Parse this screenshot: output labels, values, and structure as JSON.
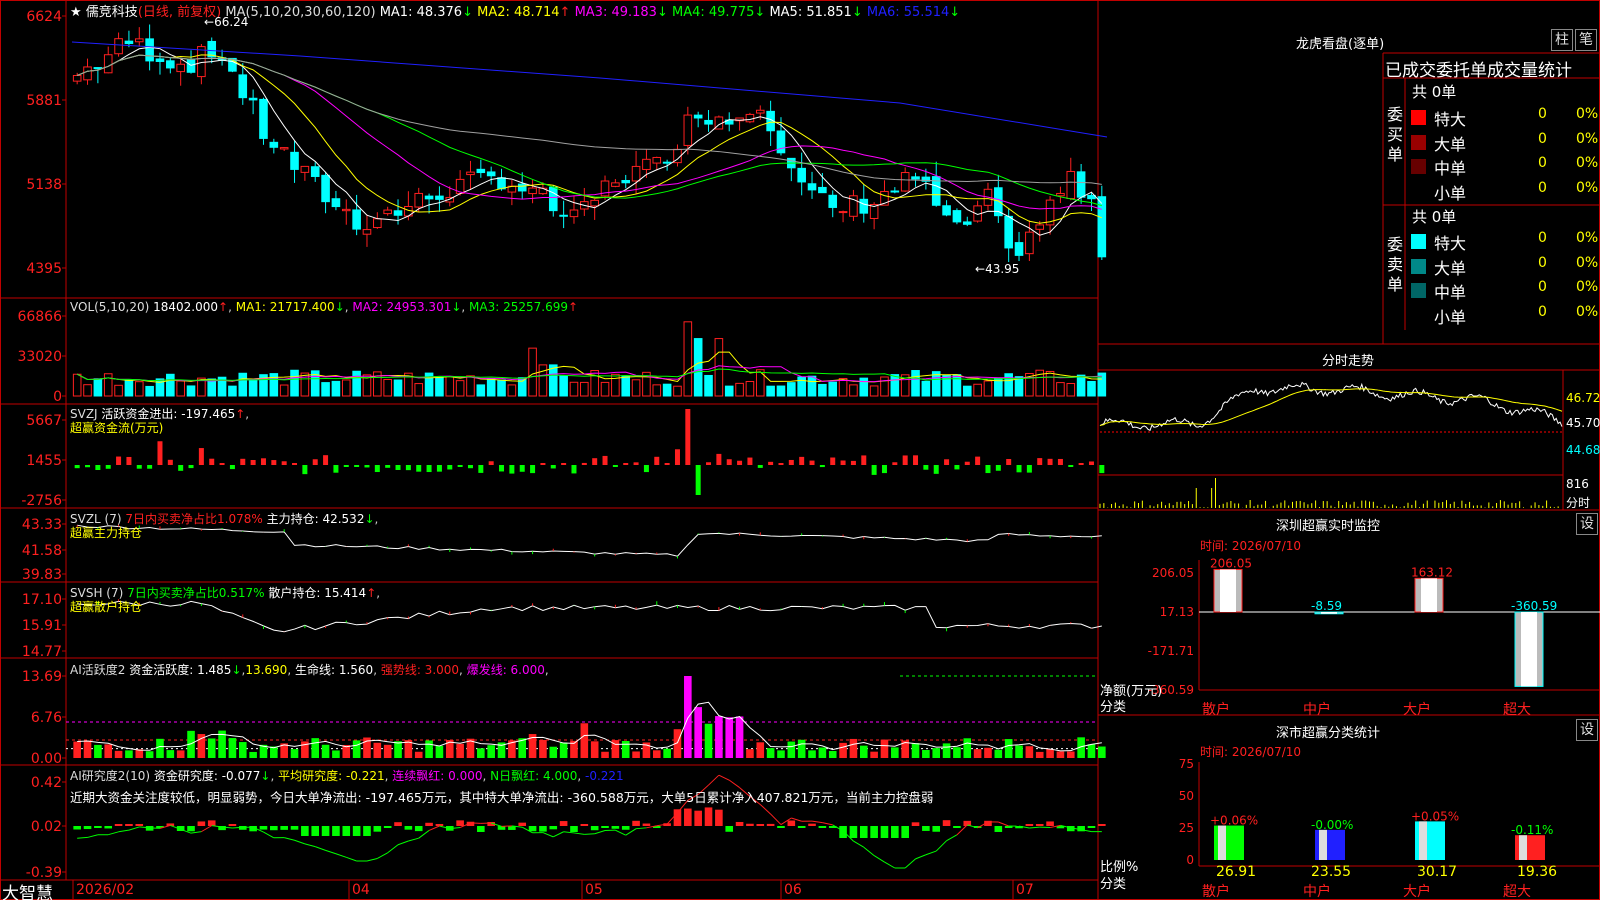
{
  "colors": {
    "up": "#ff2020",
    "down": "#00ffff",
    "ma1": "#ffffff",
    "ma2": "#ffff00",
    "ma3": "#ff00ff",
    "ma4": "#00ff00",
    "ma5": "#a0a0a0",
    "ma6": "#2020ff",
    "frame": "#c00000"
  },
  "main_chart": {
    "icon": "star-icon",
    "stock_name": "儒竞科技",
    "period": "(日线, 前复权)",
    "ma_def": "MA(5,10,20,30,60,120)",
    "ma_values": [
      {
        "label": "MA1: 48.376",
        "arrow": "↓"
      },
      {
        "label": "MA2: 48.714",
        "arrow": "↑"
      },
      {
        "label": "MA3: 49.183",
        "arrow": "↓"
      },
      {
        "label": "MA4: 49.775",
        "arrow": "↓"
      },
      {
        "label": "MA5: 51.851",
        "arrow": "↓"
      },
      {
        "label": "MA6: 55.514",
        "arrow": "↓"
      }
    ],
    "y_ticks": [
      "6624",
      "5881",
      "5138",
      "4395"
    ],
    "high_note": "66.24",
    "low_note": "43.95"
  },
  "vol_panel": {
    "title": "VOL(5,10,20)",
    "value": "18402.000",
    "ma1": "MA1: 21717.400",
    "ma2": "MA2: 24953.301",
    "ma3": "MA3: 25257.699",
    "y_ticks": [
      "66866",
      "33020",
      "0"
    ]
  },
  "svzj_panel": {
    "title": "SVZJ",
    "desc": "活跃资金进出: -197.465",
    "arrow": "↑",
    "sub": "超赢资金流(万元)",
    "y_ticks": [
      "5667",
      "1455",
      "-2756"
    ]
  },
  "svzl_panel": {
    "title": "SVZL (7)",
    "ratio": "7日内买卖净占比1.078%",
    "holding": "主力持仓: 42.532",
    "arrow": "↓",
    "sub": "超赢主力持仓",
    "y_ticks": [
      "43.33",
      "41.58",
      "39.83"
    ]
  },
  "svsh_panel": {
    "title": "SVSH (7)",
    "ratio": "7日内买卖净占比0.517%",
    "holding": "散户持仓: 15.414",
    "arrow": "↑",
    "sub": "超赢散户持仓",
    "y_ticks": [
      "17.10",
      "15.91",
      "14.77"
    ]
  },
  "ai_panel": {
    "title": "AI活跃度2",
    "activity": "资金活跃度: 1.485",
    "v2": "13.690",
    "life": "生命线: 1.560",
    "strong": "强势线: 3.000",
    "burst": "爆发线: 6.000",
    "y_ticks": [
      "13.69",
      "6.76",
      "0.00"
    ]
  },
  "research_panel": {
    "title": "AI研究度2(10)",
    "research": "资金研究度: -0.077",
    "avg": "平均研究度: -0.221",
    "consec": "连续飘红: 0.000",
    "nday": "N日飘红: 4.000",
    "last": "-0.221",
    "note": "近期大资金关注度较低，明显弱势，今日大单净流出: -197.465万元，其中特大单净流出: -360.588万元，大单5日累计净入407.821万元，当前主力控盘弱",
    "y_ticks": [
      "0.42",
      "0.02",
      "-0.39"
    ]
  },
  "x_axis": {
    "labels": [
      "2026/02",
      "04",
      "05",
      "06",
      "07"
    ],
    "brand": "大智慧"
  },
  "right": {
    "lhb_title": "龙虎看盘(逐单)",
    "btn_bar": "柱",
    "btn_pen": "笔",
    "stat_title": "已成交委托单成交量统计",
    "buy": {
      "side": "委买单",
      "total": "共 0单",
      "rows": [
        {
          "name": "特大",
          "v": "0",
          "p": "0%",
          "c": "#ff0000"
        },
        {
          "name": "大单",
          "v": "0",
          "p": "0%",
          "c": "#990000"
        },
        {
          "name": "中单",
          "v": "0",
          "p": "0%",
          "c": "#660000"
        },
        {
          "name": "小单",
          "v": "0",
          "p": "0%",
          "c": "#000000"
        }
      ]
    },
    "sell": {
      "side": "委卖单",
      "total": "共 0单",
      "rows": [
        {
          "name": "特大",
          "v": "0",
          "p": "0%",
          "c": "#00ffff"
        },
        {
          "name": "大单",
          "v": "0",
          "p": "0%",
          "c": "#008888"
        },
        {
          "name": "中单",
          "v": "0",
          "p": "0%",
          "c": "#006666"
        },
        {
          "name": "小单",
          "v": "0",
          "p": "0%",
          "c": "#000000"
        }
      ]
    },
    "intraday": {
      "title": "分时走势",
      "prices": [
        "46.72",
        "45.70",
        "44.68"
      ],
      "vol": "816",
      "vol_unit": "分时"
    },
    "monitor": {
      "title": "深圳超赢实时监控",
      "set": "设",
      "time": "时间: 2026/07/10",
      "y_ticks": [
        "206.05",
        "17.13",
        "-171.71",
        "-360.59"
      ],
      "ylabel1": "净额(万元)",
      "ylabel2": "分类",
      "bars": [
        {
          "cat": "散户",
          "value": 206.05,
          "label": "206.05",
          "color": "#ff2020"
        },
        {
          "cat": "中户",
          "value": -8.59,
          "label": "-8.59",
          "color": "#00ffff"
        },
        {
          "cat": "大户",
          "value": 163.12,
          "label": "163.12",
          "color": "#ff2020"
        },
        {
          "cat": "超大",
          "value": -360.59,
          "label": "-360.59",
          "color": "#00ffff"
        }
      ]
    },
    "classify": {
      "title": "深市超赢分类统计",
      "set": "设",
      "time": "时间: 2026/07/10",
      "y_ticks": [
        "75",
        "50",
        "25",
        "0"
      ],
      "ylabel1": "比例%",
      "ylabel2": "分类",
      "bars": [
        {
          "cat": "散户",
          "value": 26.91,
          "label": "26.91",
          "chg": "+0.06%",
          "fill": "#00ff00",
          "chgc": "#ff2020"
        },
        {
          "cat": "中户",
          "value": 23.55,
          "label": "23.55",
          "chg": "-0.00%",
          "fill": "#2020ff",
          "chgc": "#00ff00"
        },
        {
          "cat": "大户",
          "value": 30.17,
          "label": "30.17",
          "chg": "+0.05%",
          "fill": "#00ffff",
          "chgc": "#ff2020"
        },
        {
          "cat": "超大",
          "value": 19.36,
          "label": "19.36",
          "chg": "-0.11%",
          "fill": "#ff2020",
          "chgc": "#00ff00"
        }
      ]
    }
  }
}
